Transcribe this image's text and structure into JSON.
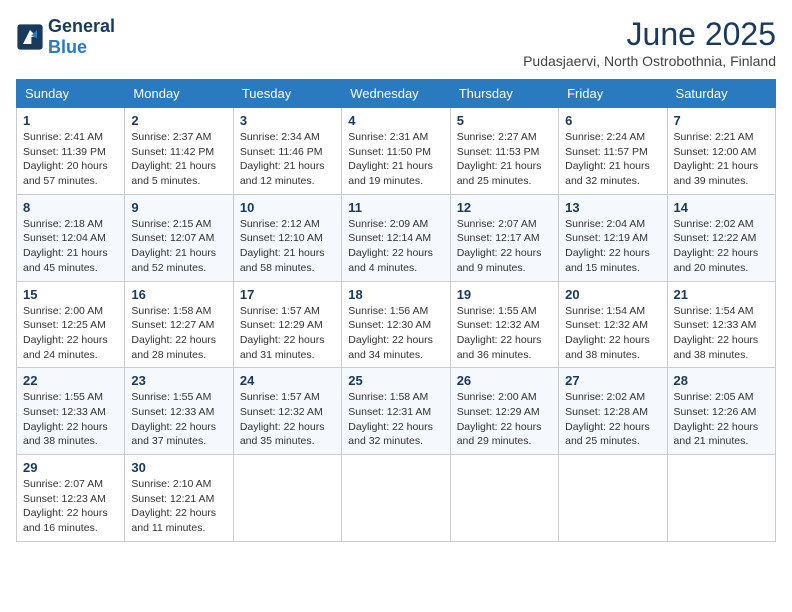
{
  "logo": {
    "text_general": "General",
    "text_blue": "Blue"
  },
  "title": "June 2025",
  "subtitle": "Pudasjaervi, North Ostrobothnia, Finland",
  "headers": [
    "Sunday",
    "Monday",
    "Tuesday",
    "Wednesday",
    "Thursday",
    "Friday",
    "Saturday"
  ],
  "weeks": [
    [
      {
        "day": "1",
        "info": "Sunrise: 2:41 AM\nSunset: 11:39 PM\nDaylight: 20 hours\nand 57 minutes."
      },
      {
        "day": "2",
        "info": "Sunrise: 2:37 AM\nSunset: 11:42 PM\nDaylight: 21 hours\nand 5 minutes."
      },
      {
        "day": "3",
        "info": "Sunrise: 2:34 AM\nSunset: 11:46 PM\nDaylight: 21 hours\nand 12 minutes."
      },
      {
        "day": "4",
        "info": "Sunrise: 2:31 AM\nSunset: 11:50 PM\nDaylight: 21 hours\nand 19 minutes."
      },
      {
        "day": "5",
        "info": "Sunrise: 2:27 AM\nSunset: 11:53 PM\nDaylight: 21 hours\nand 25 minutes."
      },
      {
        "day": "6",
        "info": "Sunrise: 2:24 AM\nSunset: 11:57 PM\nDaylight: 21 hours\nand 32 minutes."
      },
      {
        "day": "7",
        "info": "Sunrise: 2:21 AM\nSunset: 12:00 AM\nDaylight: 21 hours\nand 39 minutes."
      }
    ],
    [
      {
        "day": "8",
        "info": "Sunrise: 2:18 AM\nSunset: 12:04 AM\nDaylight: 21 hours\nand 45 minutes."
      },
      {
        "day": "9",
        "info": "Sunrise: 2:15 AM\nSunset: 12:07 AM\nDaylight: 21 hours\nand 52 minutes."
      },
      {
        "day": "10",
        "info": "Sunrise: 2:12 AM\nSunset: 12:10 AM\nDaylight: 21 hours\nand 58 minutes."
      },
      {
        "day": "11",
        "info": "Sunrise: 2:09 AM\nSunset: 12:14 AM\nDaylight: 22 hours\nand 4 minutes."
      },
      {
        "day": "12",
        "info": "Sunrise: 2:07 AM\nSunset: 12:17 AM\nDaylight: 22 hours\nand 9 minutes."
      },
      {
        "day": "13",
        "info": "Sunrise: 2:04 AM\nSunset: 12:19 AM\nDaylight: 22 hours\nand 15 minutes."
      },
      {
        "day": "14",
        "info": "Sunrise: 2:02 AM\nSunset: 12:22 AM\nDaylight: 22 hours\nand 20 minutes."
      }
    ],
    [
      {
        "day": "15",
        "info": "Sunrise: 2:00 AM\nSunset: 12:25 AM\nDaylight: 22 hours\nand 24 minutes."
      },
      {
        "day": "16",
        "info": "Sunrise: 1:58 AM\nSunset: 12:27 AM\nDaylight: 22 hours\nand 28 minutes."
      },
      {
        "day": "17",
        "info": "Sunrise: 1:57 AM\nSunset: 12:29 AM\nDaylight: 22 hours\nand 31 minutes."
      },
      {
        "day": "18",
        "info": "Sunrise: 1:56 AM\nSunset: 12:30 AM\nDaylight: 22 hours\nand 34 minutes."
      },
      {
        "day": "19",
        "info": "Sunrise: 1:55 AM\nSunset: 12:32 AM\nDaylight: 22 hours\nand 36 minutes."
      },
      {
        "day": "20",
        "info": "Sunrise: 1:54 AM\nSunset: 12:32 AM\nDaylight: 22 hours\nand 38 minutes."
      },
      {
        "day": "21",
        "info": "Sunrise: 1:54 AM\nSunset: 12:33 AM\nDaylight: 22 hours\nand 38 minutes."
      }
    ],
    [
      {
        "day": "22",
        "info": "Sunrise: 1:55 AM\nSunset: 12:33 AM\nDaylight: 22 hours\nand 38 minutes."
      },
      {
        "day": "23",
        "info": "Sunrise: 1:55 AM\nSunset: 12:33 AM\nDaylight: 22 hours\nand 37 minutes."
      },
      {
        "day": "24",
        "info": "Sunrise: 1:57 AM\nSunset: 12:32 AM\nDaylight: 22 hours\nand 35 minutes."
      },
      {
        "day": "25",
        "info": "Sunrise: 1:58 AM\nSunset: 12:31 AM\nDaylight: 22 hours\nand 32 minutes."
      },
      {
        "day": "26",
        "info": "Sunrise: 2:00 AM\nSunset: 12:29 AM\nDaylight: 22 hours\nand 29 minutes."
      },
      {
        "day": "27",
        "info": "Sunrise: 2:02 AM\nSunset: 12:28 AM\nDaylight: 22 hours\nand 25 minutes."
      },
      {
        "day": "28",
        "info": "Sunrise: 2:05 AM\nSunset: 12:26 AM\nDaylight: 22 hours\nand 21 minutes."
      }
    ],
    [
      {
        "day": "29",
        "info": "Sunrise: 2:07 AM\nSunset: 12:23 AM\nDaylight: 22 hours\nand 16 minutes."
      },
      {
        "day": "30",
        "info": "Sunrise: 2:10 AM\nSunset: 12:21 AM\nDaylight: 22 hours\nand 11 minutes."
      },
      null,
      null,
      null,
      null,
      null
    ]
  ]
}
